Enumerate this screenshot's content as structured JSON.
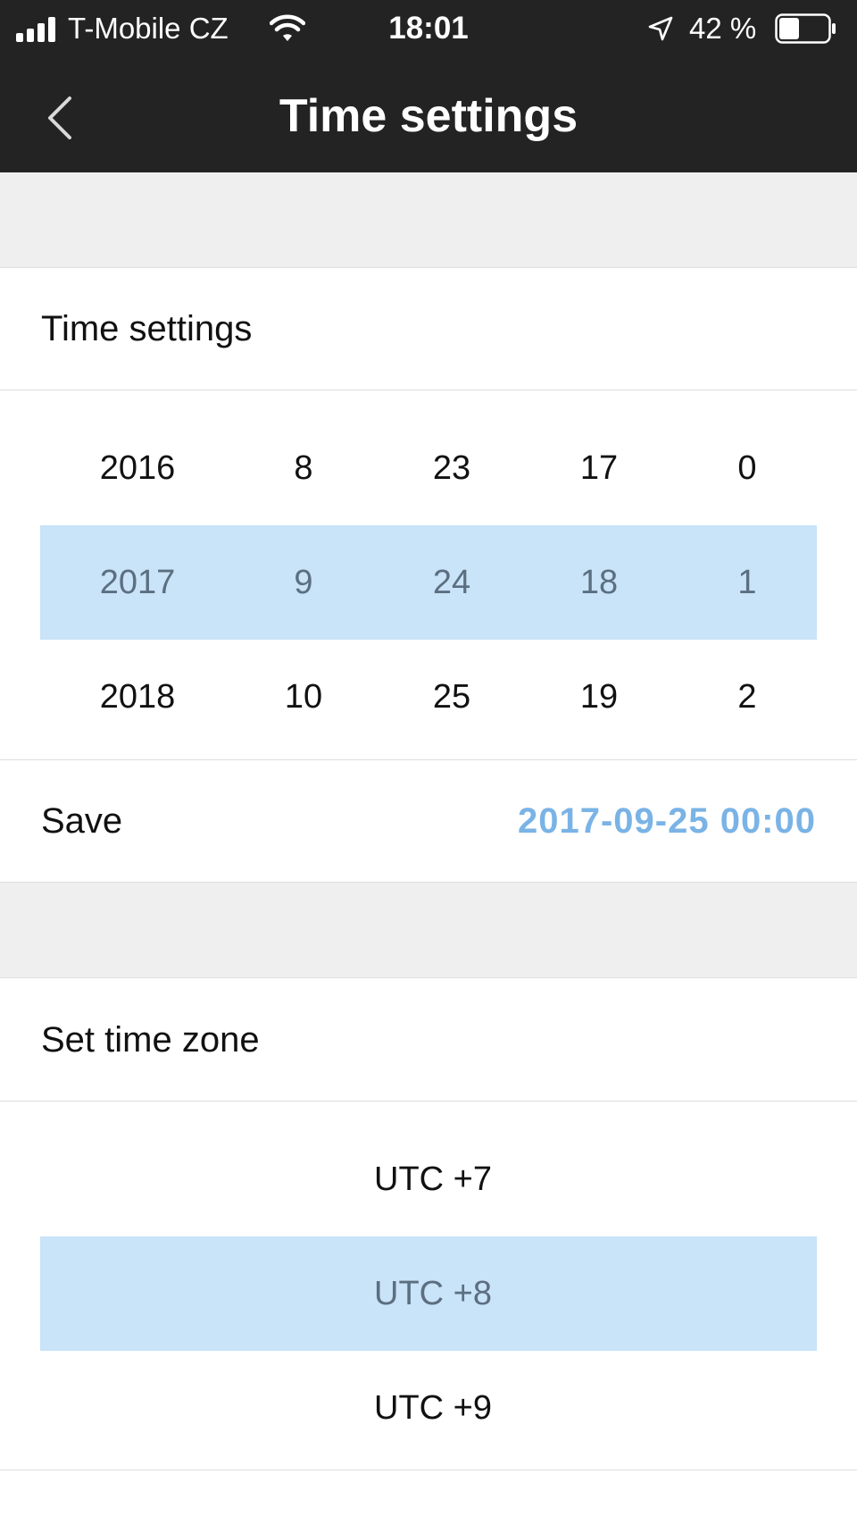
{
  "status_bar": {
    "carrier": "T-Mobile CZ",
    "time": "18:01",
    "battery_percent": "42 %",
    "battery_level": 0.42,
    "icons": [
      "signal-icon",
      "wifi-icon",
      "location-arrow-icon",
      "battery-icon"
    ]
  },
  "header": {
    "title": "Time settings",
    "back_icon": "chevron-left-icon"
  },
  "time_section": {
    "label": "Time settings",
    "picker": {
      "rows": [
        [
          "2016",
          "8",
          "23",
          "17",
          "0"
        ],
        [
          "2017",
          "9",
          "24",
          "18",
          "1"
        ],
        [
          "2018",
          "10",
          "25",
          "19",
          "2"
        ]
      ],
      "selected_row": 1
    },
    "save_label": "Save",
    "save_value": "2017-09-25 00:00"
  },
  "timezone_section": {
    "label": "Set time zone",
    "options": [
      "UTC +7",
      "UTC +8",
      "UTC +9"
    ],
    "selected_index": 1
  },
  "colors": {
    "header_bg": "#232323",
    "selection_bg": "#c9e3f8",
    "accent": "#7ab3e6",
    "section_gap": "#efefef"
  }
}
